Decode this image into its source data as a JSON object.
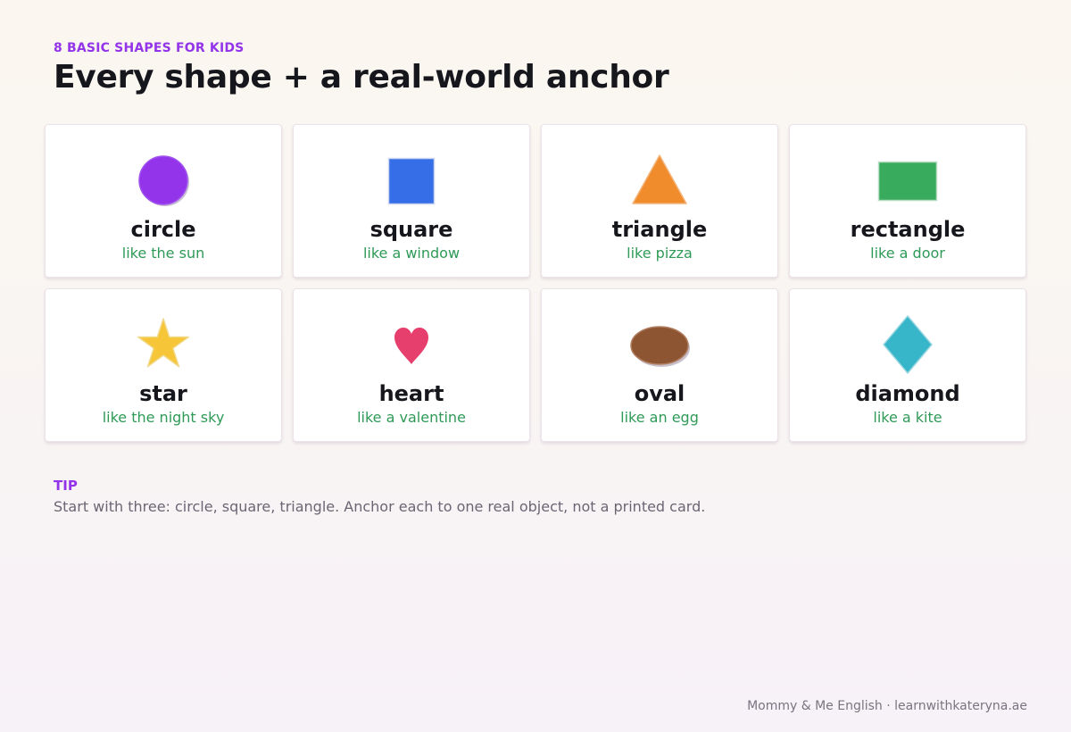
{
  "eyebrow": "8 BASIC SHAPES FOR KIDS",
  "title": "Every shape + a real-world anchor",
  "shapes": [
    {
      "name": "circle",
      "anchor": "like the sun",
      "icon": "circle-icon",
      "color": "#9333ea"
    },
    {
      "name": "square",
      "anchor": "like a window",
      "icon": "square-icon",
      "color": "#356ee6"
    },
    {
      "name": "triangle",
      "anchor": "like pizza",
      "icon": "triangle-icon",
      "color": "#f08c2c"
    },
    {
      "name": "rectangle",
      "anchor": "like a door",
      "icon": "rectangle-icon",
      "color": "#38ac5c"
    },
    {
      "name": "star",
      "anchor": "like the night sky",
      "icon": "star-icon",
      "color": "#f6c638"
    },
    {
      "name": "heart",
      "anchor": "like a valentine",
      "icon": "heart-icon",
      "color": "#e63f6d"
    },
    {
      "name": "oval",
      "anchor": "like an egg",
      "icon": "oval-icon",
      "color": "#8e5533"
    },
    {
      "name": "diamond",
      "anchor": "like a kite",
      "icon": "diamond-icon",
      "color": "#38b6c9"
    }
  ],
  "tip": {
    "label": "TIP",
    "text": "Start with three: circle, square, triangle. Anchor each to one real object, not a printed card."
  },
  "footer": "Mommy & Me English · learnwithkateryna.ae",
  "colors": {
    "accent": "#9333ea",
    "anchor_text": "#2f9a57"
  }
}
